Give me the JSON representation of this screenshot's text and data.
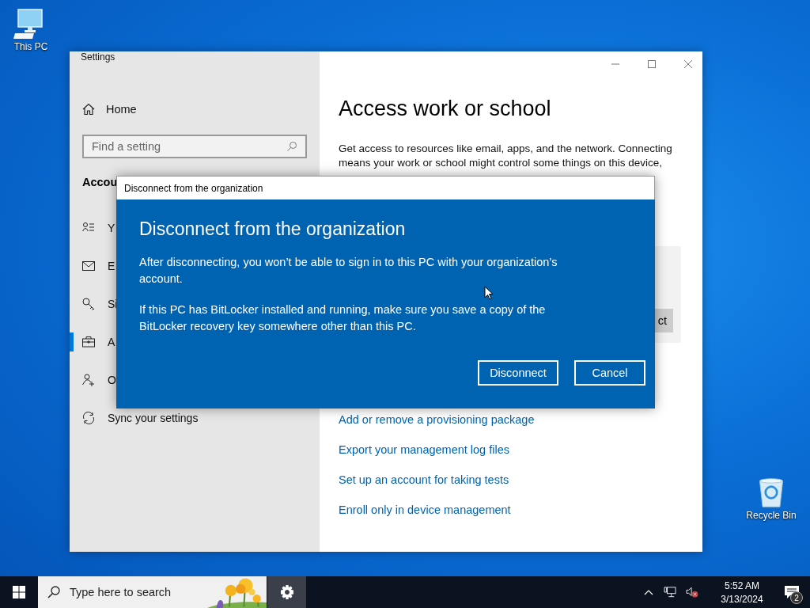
{
  "desktop_icons": [
    {
      "label": "This PC"
    },
    {
      "label": "Recycle Bin"
    }
  ],
  "settings_window": {
    "title": "Settings",
    "sidebar": {
      "home": "Home",
      "search_placeholder": "Find a setting",
      "section": "Accou",
      "items": [
        {
          "label": "Y",
          "selected": false
        },
        {
          "label": "E",
          "selected": false
        },
        {
          "label": "Si",
          "selected": false
        },
        {
          "label": "A",
          "selected": true
        },
        {
          "label": "O",
          "selected": false
        },
        {
          "label": "Sync your settings",
          "selected": false
        }
      ]
    },
    "content": {
      "heading": "Access work or school",
      "description": "Get access to resources like email, apps, and the network. Connecting means your work or school might control some things on this device,",
      "panel_button": "ct",
      "links": [
        "Add or remove a provisioning package",
        "Export your management log files",
        "Set up an account for taking tests",
        "Enroll only in device management"
      ]
    }
  },
  "dialog": {
    "title": "Disconnect from the organization",
    "heading": "Disconnect from the organization",
    "paragraphs": [
      "After disconnecting, you won’t be able to sign in to this PC with your organization’s account.",
      "If this PC has BitLocker installed and running, make sure you save a copy of the BitLocker recovery key somewhere other than this PC."
    ],
    "buttons": [
      "Disconnect",
      "Cancel"
    ]
  },
  "taskbar": {
    "search_placeholder": "Type here to search",
    "time": "5:52 AM",
    "date": "3/13/2024",
    "notification_count": "2"
  }
}
